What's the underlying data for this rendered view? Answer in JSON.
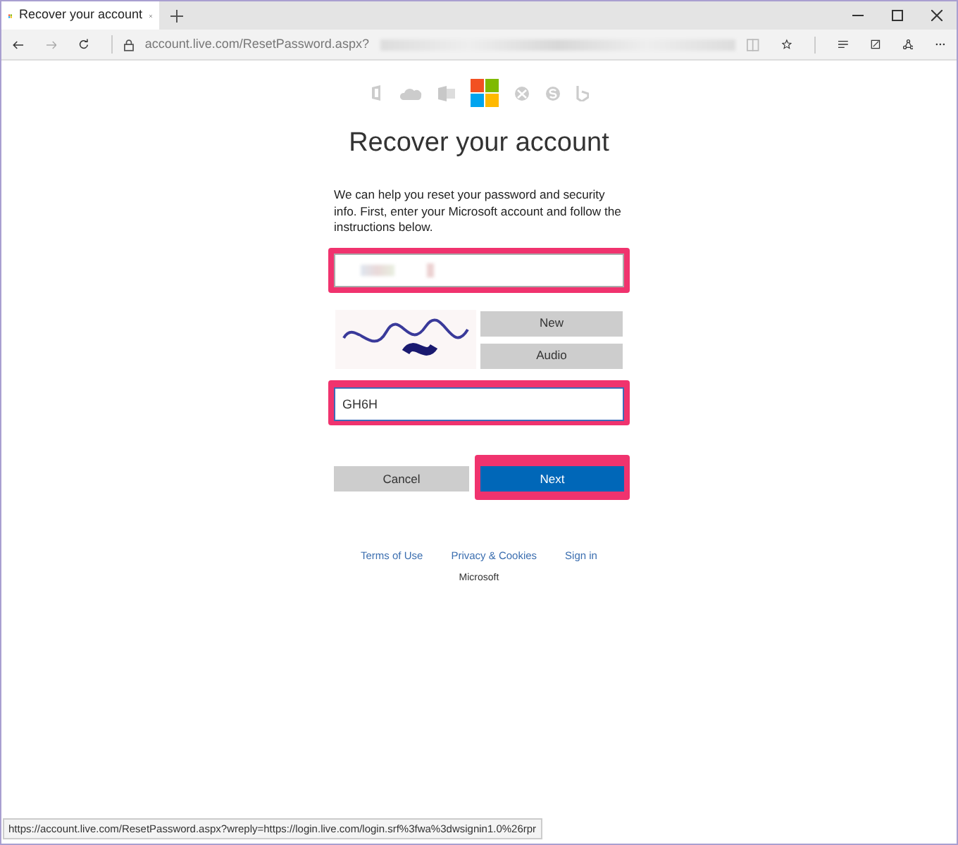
{
  "browser": {
    "tab_title": "Recover your account",
    "address": "account.live.com/ResetPassword.aspx?",
    "status_url": "https://account.live.com/ResetPassword.aspx?wreply=https://login.live.com/login.srf%3fwa%3dwsignin1.0%26rpr"
  },
  "page": {
    "title": "Recover your account",
    "intro": "We can help you reset your password and security info. First, enter your Microsoft account and follow the instructions below.",
    "account_field": {
      "highlighted": true
    },
    "captcha_buttons": [
      "New",
      "Audio"
    ],
    "code_field": {
      "value": "GH6H",
      "highlighted": true
    },
    "buttons": [
      {
        "label": "Cancel",
        "kind": "secondary",
        "highlighted": false
      },
      {
        "label": "Next",
        "kind": "primary",
        "highlighted": true
      }
    ],
    "footer_links": [
      "Terms of Use",
      "Privacy & Cookies",
      "Sign in"
    ],
    "footer_brand": "Microsoft"
  }
}
